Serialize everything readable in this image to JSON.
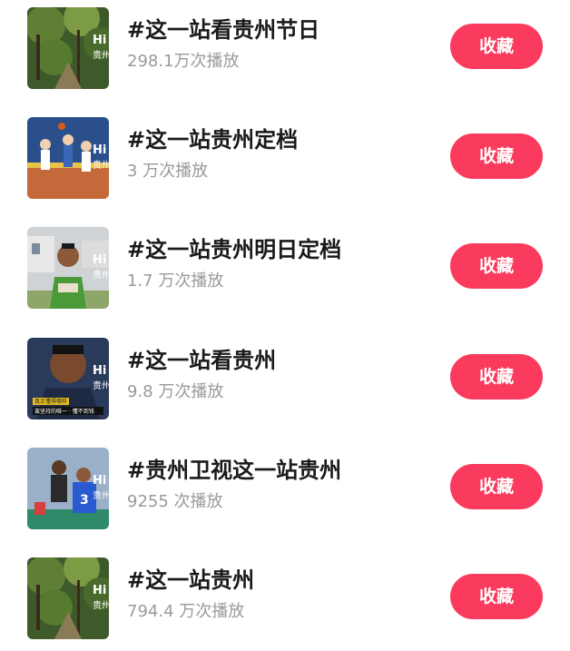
{
  "items": [
    {
      "title": "#这一站看贵州节日",
      "plays": "298.1万次播放",
      "button": "收藏",
      "thumb": "forest",
      "badge": "Hi",
      "badge_sub": "贵州"
    },
    {
      "title": "#这一站贵州定档",
      "plays": "3 万次播放",
      "button": "收藏",
      "thumb": "basketball-court",
      "badge": "Hi",
      "badge_sub": "贵州"
    },
    {
      "title": "#这一站贵州明日定档",
      "plays": "1.7 万次播放",
      "button": "收藏",
      "thumb": "man-outdoor",
      "badge": "Hi",
      "badge_sub": "贵州"
    },
    {
      "title": "#这一站看贵州",
      "plays": "9.8 万次播放",
      "button": "收藏",
      "thumb": "man-closeup",
      "badge": "Hi",
      "badge_sub": "贵州",
      "caption_top": "真正懂得哪样",
      "caption_bottom": "蛮坚持的唯一 · 懂不到钱"
    },
    {
      "title": "#贵州卫视这一站贵州",
      "plays": "9255 次播放",
      "button": "收藏",
      "thumb": "basketball-players",
      "badge": "Hi",
      "badge_sub": "贵州"
    },
    {
      "title": "#这一站贵州",
      "plays": "794.4 万次播放",
      "button": "收藏",
      "thumb": "forest",
      "badge": "Hi",
      "badge_sub": "贵州"
    }
  ]
}
